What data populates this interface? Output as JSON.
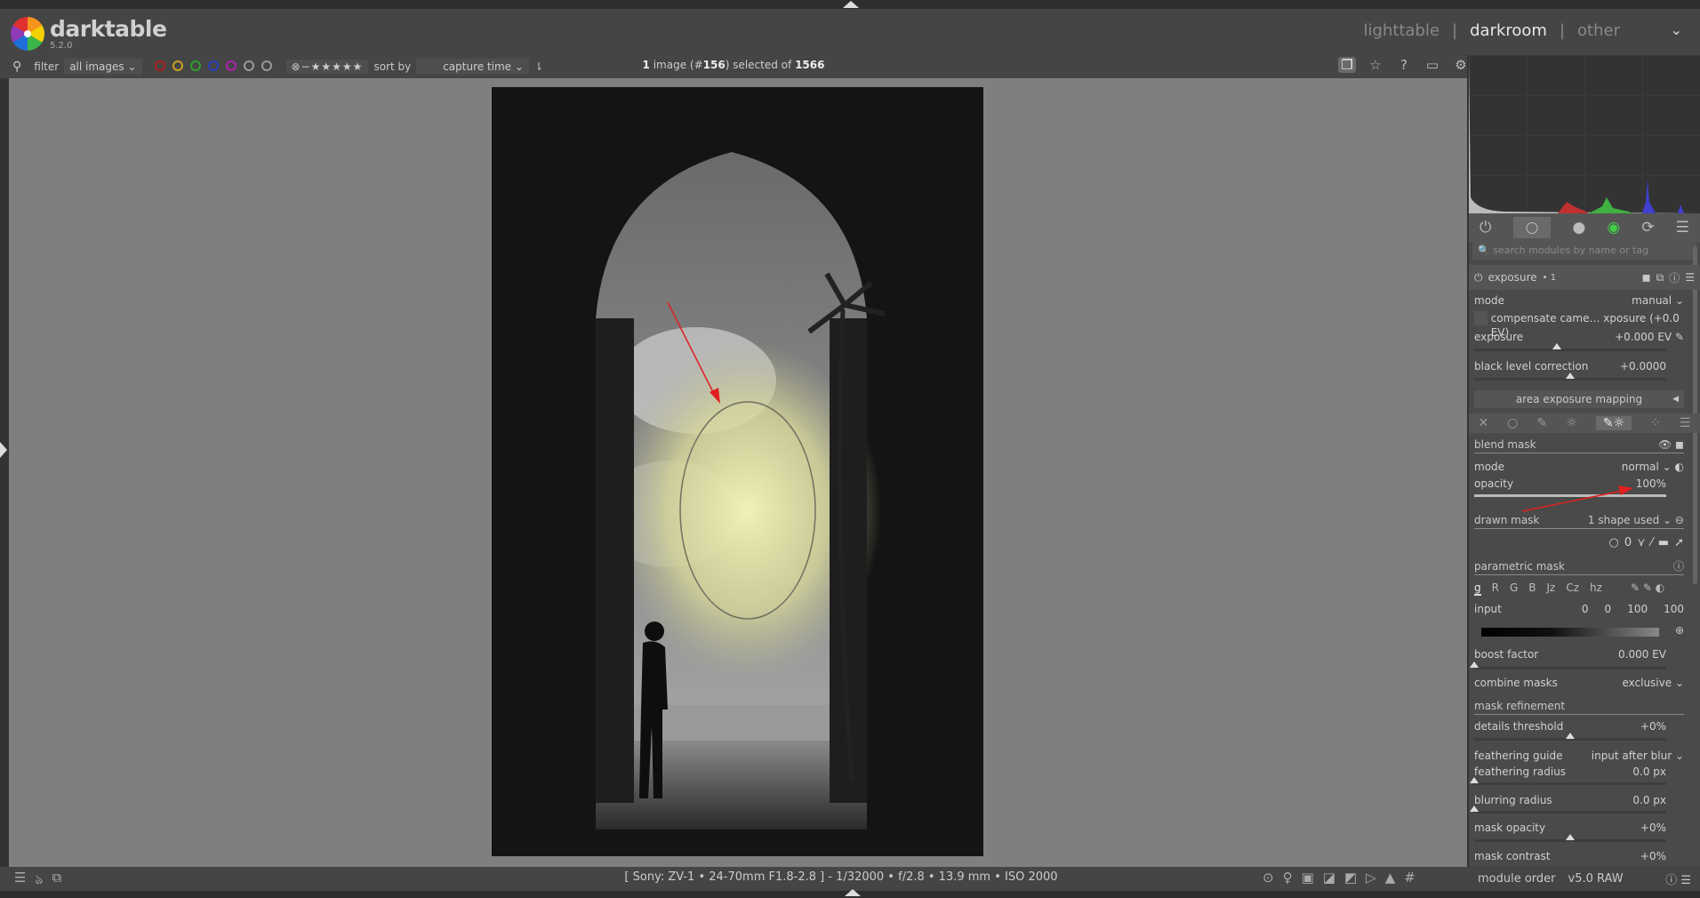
{
  "app": {
    "name": "darktable",
    "version": "5.2.0"
  },
  "views": {
    "items": [
      "lighttable",
      "darkroom",
      "other"
    ],
    "separator": "|",
    "active": "darkroom"
  },
  "filterbar": {
    "filter_label": "filter",
    "filter_value": "all images",
    "sort_label": "sort by",
    "sort_value": "capture time",
    "color_labels": [
      "#b02020",
      "#c8a020",
      "#2fa02f",
      "#2a3fc0",
      "#b020b0",
      "#9a9a9a"
    ],
    "rating": "⊗−★★★★★"
  },
  "selection": {
    "count": "1",
    "text1": " image (#",
    "id": "156",
    "text2": ") selected of ",
    "total": "1566"
  },
  "statusbar": {
    "exif": "[ Sony: ZV-1 • 24-70mm F1.8-2.8 ]  -  1/32000 • f/2.8 • 13.9 mm • ISO 2000"
  },
  "search": {
    "placeholder": "search modules by name or tag"
  },
  "module": {
    "name": "exposure",
    "instance": "• 1",
    "mode_label": "mode",
    "mode_value": "manual",
    "compensate_label": "compensate came… xposure (+0.0 EV)",
    "exposure_label": "exposure",
    "exposure_value": "+0.000 EV",
    "exposure_marker": 0.43,
    "black_label": "black level correction",
    "black_value": "+0.0000",
    "black_marker": 0.5,
    "aem_label": "area exposure mapping"
  },
  "blend": {
    "title": "blend mask",
    "mode_label": "mode",
    "mode_value": "normal",
    "opacity_label": "opacity",
    "opacity_value": "100%",
    "opacity_fraction": 1.0,
    "drawn_label": "drawn mask",
    "drawn_value": "1 shape used",
    "parametric_label": "parametric mask",
    "channels": [
      "g",
      "R",
      "G",
      "B",
      "Jz",
      "Cz",
      "hz"
    ],
    "input_label": "input",
    "input_values": [
      "0",
      "0",
      "100",
      "100"
    ],
    "boost_label": "boost factor",
    "boost_value": "0.000 EV",
    "boost_marker": 0,
    "combine_label": "combine masks",
    "combine_value": "exclusive",
    "refinement_label": "mask refinement",
    "details_label": "details threshold",
    "details_value": "+0%",
    "details_marker": 0.5,
    "guide_label": "feathering guide",
    "guide_value": "input after blur",
    "feather_label": "feathering radius",
    "feather_value": "0.0 px",
    "feather_marker": 0,
    "blur_label": "blurring radius",
    "blur_value": "0.0 px",
    "blur_marker": 0,
    "mopacity_label": "mask opacity",
    "mopacity_value": "+0%",
    "mopacity_marker": 0.5,
    "mcontrast_label": "mask contrast",
    "mcontrast_value": "+0%"
  },
  "module_order": {
    "label": "module order",
    "value": "v5.0 RAW"
  },
  "annotation_color": "#e02020"
}
